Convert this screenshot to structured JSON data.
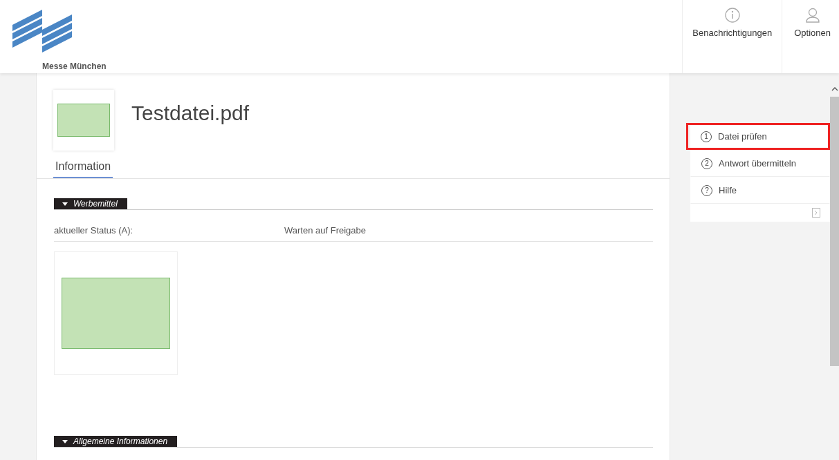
{
  "header": {
    "brand": "Messe München",
    "nav": [
      {
        "kind": "info",
        "label": "Benachrichtigungen"
      },
      {
        "kind": "user",
        "label": "Optionen"
      }
    ]
  },
  "file": {
    "title": "Testdatei.pdf"
  },
  "tabs": [
    {
      "label": "Information",
      "selected": true
    }
  ],
  "sections": [
    {
      "title": "Werbemittel",
      "expanded": true,
      "fields": [
        {
          "label": "aktueller Status (A):",
          "value": "Warten auf Freigabe"
        }
      ],
      "preview": true
    },
    {
      "title": "Allgemeine Informationen",
      "expanded": true,
      "preview": false
    }
  ],
  "steps": [
    {
      "marker": "1",
      "label": "Datei prüfen",
      "highlighted": true
    },
    {
      "marker": "2",
      "label": "Antwort übermitteln",
      "highlighted": false
    },
    {
      "marker": "?",
      "label": "Hilfe",
      "highlighted": false
    }
  ]
}
